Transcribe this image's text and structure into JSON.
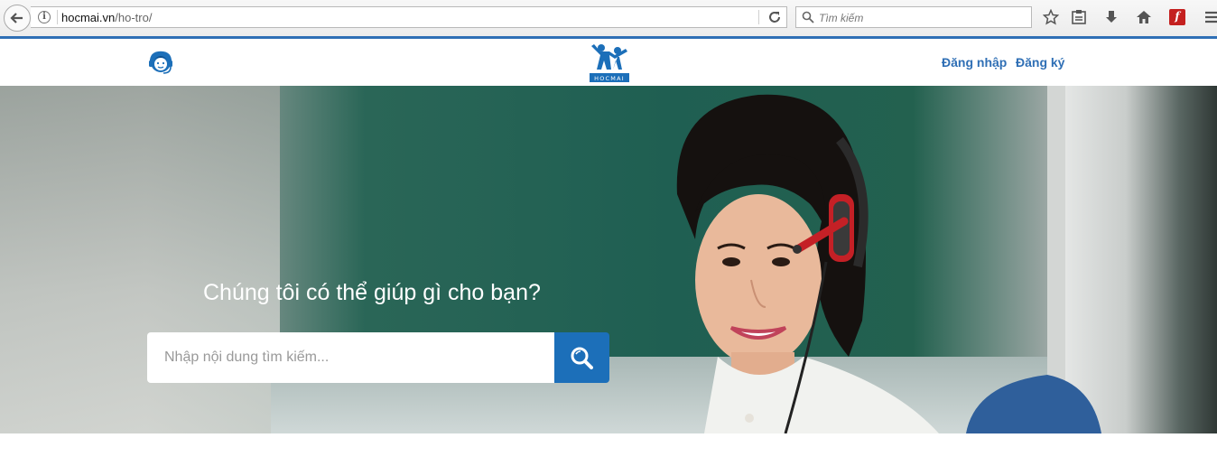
{
  "browser": {
    "url_domain": "hocmai.vn",
    "url_path": "/ho-tro/",
    "search_placeholder": "Tìm kiếm",
    "toolbar_icons": [
      "bookmark-star-icon",
      "reading-list-icon",
      "download-icon",
      "home-icon",
      "flash-icon",
      "menu-icon"
    ],
    "flash_glyph": "f"
  },
  "header": {
    "logo_text": "HOCMAI",
    "nav": {
      "login": "Đăng nhập",
      "register": "Đăng ký"
    }
  },
  "hero": {
    "title": "Chúng tôi có thể giúp gì cho bạn?",
    "search_placeholder": "Nhập nội dung tìm kiếm..."
  },
  "colors": {
    "brand": "#2f6fb5",
    "search_button": "#1c6fb9"
  }
}
